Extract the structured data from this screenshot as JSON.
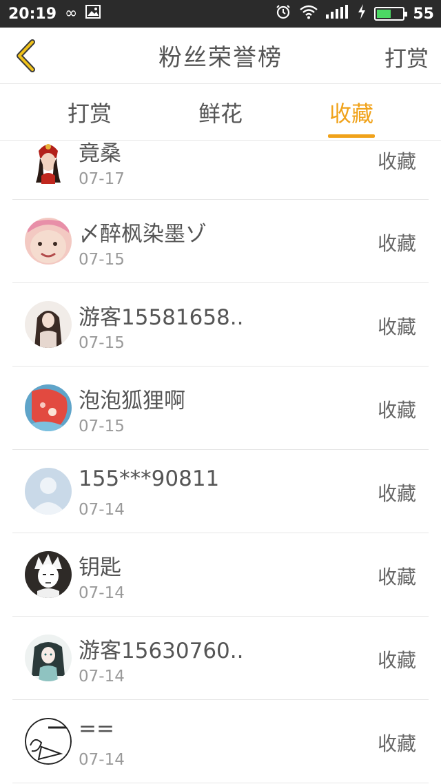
{
  "statusbar": {
    "time": "20:19",
    "battery": "55",
    "icons": [
      "infinity-icon",
      "image-icon",
      "alarm-icon",
      "wifi-icon",
      "signal-icon",
      "charging-icon",
      "battery-icon"
    ],
    "battery_level": 0.55,
    "battery_color": "#4cd964"
  },
  "header": {
    "back_icon": "chevron-left-icon",
    "title": "粉丝荣誉榜",
    "right_action": "打赏"
  },
  "tabs": [
    {
      "label": "打赏",
      "active": false
    },
    {
      "label": "鲜花",
      "active": false
    },
    {
      "label": "收藏",
      "active": true
    }
  ],
  "accent_color": "#f0a21a",
  "fans": [
    {
      "name": "竟桑",
      "date": "07-17",
      "action": "收藏",
      "avatar": "avatar-ancient-girl"
    },
    {
      "name": "〆醉枫染墨ゾ",
      "date": "07-15",
      "action": "收藏",
      "avatar": "avatar-child"
    },
    {
      "name": "游客15581658..",
      "date": "07-15",
      "action": "收藏",
      "avatar": "avatar-girl-photo"
    },
    {
      "name": "泡泡狐狸啊",
      "date": "07-15",
      "action": "收藏",
      "avatar": "avatar-red-cartoon"
    },
    {
      "name": "155***90811",
      "date": "07-14",
      "action": "收藏",
      "avatar": "avatar-default"
    },
    {
      "name": "钥匙",
      "date": "07-14",
      "action": "收藏",
      "avatar": "avatar-anime-sketch"
    },
    {
      "name": "游客15630760..",
      "date": "07-14",
      "action": "收藏",
      "avatar": "avatar-anime-girl"
    },
    {
      "name": "==",
      "date": "07-14",
      "action": "收藏",
      "avatar": "avatar-doodle"
    }
  ]
}
